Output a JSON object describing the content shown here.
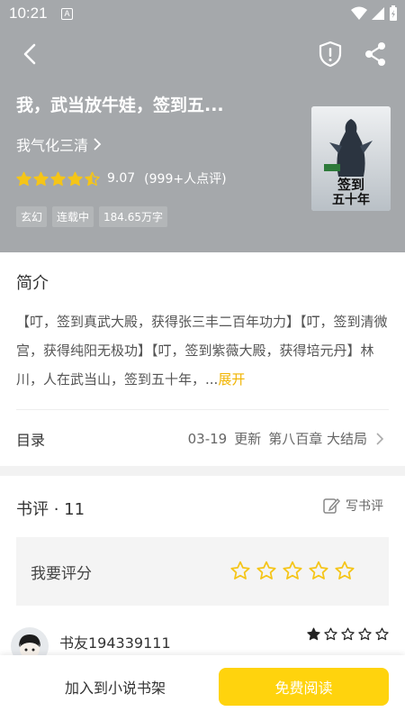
{
  "status": {
    "time": "10:21",
    "notif": "A"
  },
  "book": {
    "title": "我，武当放牛娃，签到五...",
    "author": "我气化三清",
    "score": "9.07",
    "rating_count": "(999+人点评)",
    "stars": 4.5,
    "tags": [
      "玄幻",
      "连载中",
      "184.65万字"
    ],
    "cover_title": "签到五十年"
  },
  "intro": {
    "heading": "简介",
    "text": "【叮，签到真武大殿，获得张三丰二百年功力】【叮，签到清微宫，获得纯阳无极功】【叮，签到紫薇大殿，获得培元丹】林川，人在武当山，签到五十年，...",
    "expand": "展开"
  },
  "toc": {
    "label": "目录",
    "date": "03-19",
    "update": "更新",
    "chapter": "第八百章 大结局"
  },
  "reviews": {
    "heading": "书评 · 11",
    "write": "写书评",
    "rate_label": "我要评分",
    "items": [
      {
        "name": "书友194339111",
        "stars": 1
      }
    ]
  },
  "bottom": {
    "shelf": "加入到小说书架",
    "read": "免费阅读"
  },
  "colors": {
    "accent": "#ffd30d",
    "star": "#f5c518",
    "header": "#a5a8ab",
    "expand": "#f1b400"
  }
}
